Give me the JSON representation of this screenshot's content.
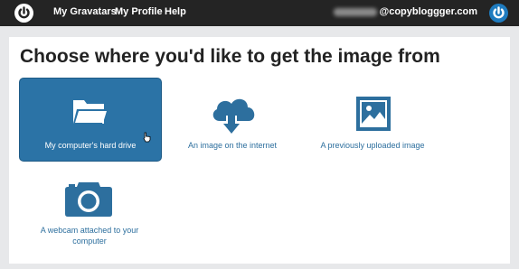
{
  "topbar": {
    "logo_icon": "gravatar-logo-icon",
    "nav": [
      {
        "label": "My Gravatars"
      },
      {
        "label": "My Profile"
      },
      {
        "label": "Help"
      }
    ],
    "email_domain": "@copybloggger.com",
    "avatar_icon": "gravatar-avatar-icon"
  },
  "main": {
    "title": "Choose where you'd like to get the image from",
    "options": [
      {
        "label": "My computer's hard drive",
        "icon": "folder-icon",
        "selected": true
      },
      {
        "label": "An image on the internet",
        "icon": "cloud-download-icon",
        "selected": false
      },
      {
        "label": "A previously uploaded image",
        "icon": "image-icon",
        "selected": false
      },
      {
        "label": "A webcam attached to your computer",
        "icon": "camera-icon",
        "selected": false
      }
    ]
  },
  "colors": {
    "topbar_bg": "#242424",
    "accent": "#2b73a6",
    "link": "#2d6f9e",
    "page_bg": "#e7e8ea"
  }
}
